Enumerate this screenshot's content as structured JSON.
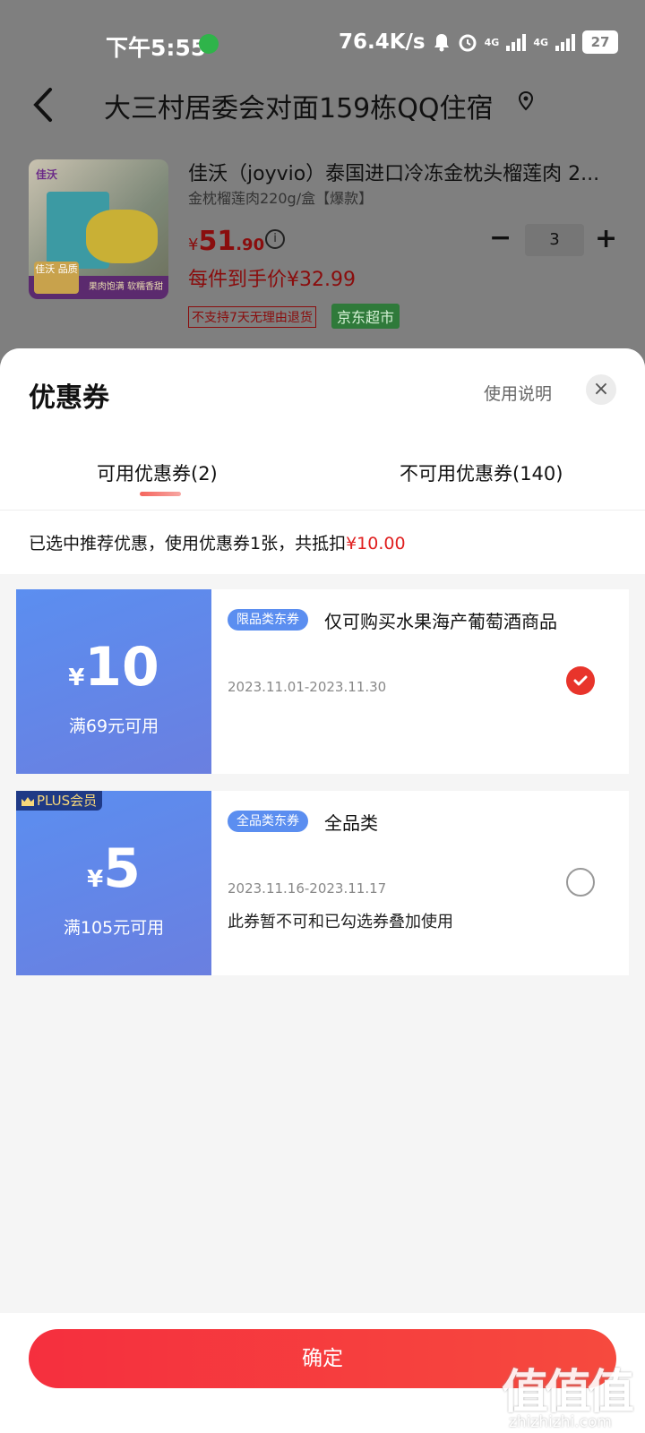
{
  "status_bar": {
    "time": "下午5:55",
    "net_speed": "76.4K/s",
    "signal_1": "4G",
    "signal_2": "4G",
    "battery": "27"
  },
  "header": {
    "address": "大三村居委会对面159栋QQ住宿"
  },
  "product": {
    "title": "佳沃（joyvio）泰国进口冷冻金枕头榴莲肉 2...",
    "spec": "金枕榴莲肉220g/盒【爆款】",
    "price_currency": "¥",
    "price_int": "51",
    "price_dec": ".90",
    "info_glyph": "i",
    "each_price": "每件到手价¥32.99",
    "quantity": "3",
    "minus": "−",
    "plus": "+",
    "tag_noreturn": "不支持7天无理由退货",
    "tag_store": "京东超市",
    "thumb_brand": "佳沃",
    "thumb_banner": "果肉饱满 软糯香甜",
    "thumb_tag": "佳沃 品质"
  },
  "sheet": {
    "title": "优惠券",
    "help": "使用说明",
    "close": "×",
    "tabs": [
      {
        "label": "可用优惠券(2)"
      },
      {
        "label": "不可用优惠券(140)"
      }
    ],
    "summary_prefix": "已选中推荐优惠，使用优惠券1张，共抵扣",
    "summary_amount": "¥10.00"
  },
  "coupons": [
    {
      "yen": "¥",
      "amount": "10",
      "threshold": "满69元可用",
      "tag": "限品类东券",
      "desc": "仅可购买水果海产葡萄酒商品",
      "date": "2023.11.01-2023.11.30",
      "note": "",
      "selected": true
    },
    {
      "badge": "PLUS会员",
      "yen": "¥",
      "amount": "5",
      "threshold": "满105元可用",
      "tag": "全品类东券",
      "desc": "全品类",
      "date": "2023.11.16-2023.11.17",
      "note": "此券暂不可和已勾选券叠加使用",
      "selected": false
    }
  ],
  "footer": {
    "confirm": "确定"
  },
  "watermark": {
    "text": "值值值",
    "url": "zhizhizhi.com"
  },
  "colors": {
    "accent": "#f52f3e",
    "price_red": "#e02020",
    "coupon_blue": "#5b8ef0",
    "overlay_gray": "#7f7f7f"
  }
}
